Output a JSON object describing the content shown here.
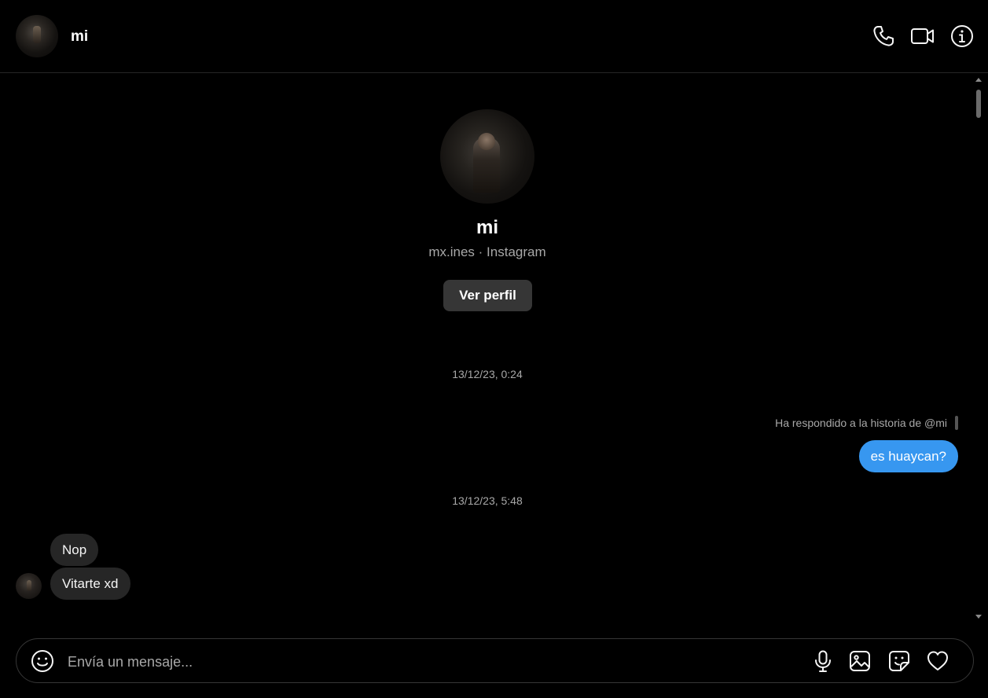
{
  "header": {
    "name": "mi",
    "icons": [
      "phone-icon",
      "video-icon",
      "info-icon"
    ]
  },
  "profile": {
    "name": "mi",
    "subtitle": "mx.ines · Instagram",
    "button_label": "Ver perfil"
  },
  "messages": {
    "timestamp_1": "13/12/23, 0:24",
    "reply_note": "Ha respondido a la historia de @mi",
    "outgoing_1": "es huaycan?",
    "timestamp_2": "13/12/23, 5:48",
    "incoming_1": "Nop",
    "incoming_2": "Vitarte xd"
  },
  "composer": {
    "placeholder": "Envía un mensaje...",
    "icons": [
      "emoji-icon",
      "microphone-icon",
      "image-icon",
      "sticker-icon",
      "heart-icon"
    ]
  },
  "colors": {
    "background": "#000000",
    "outgoing_bubble": "#3797f0",
    "incoming_bubble": "#262626",
    "secondary_text": "#a8a8a8"
  }
}
